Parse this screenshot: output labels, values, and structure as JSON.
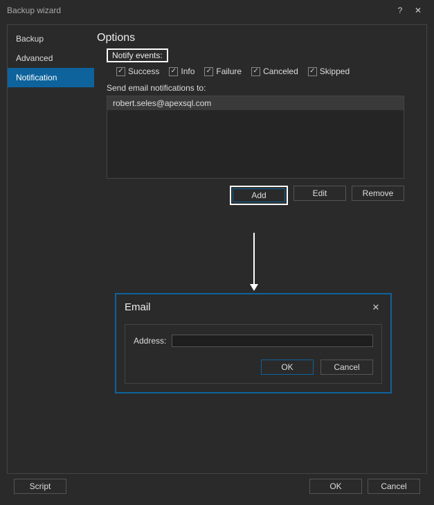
{
  "window": {
    "title": "Backup wizard"
  },
  "sidebar": {
    "items": [
      {
        "label": "Backup"
      },
      {
        "label": "Advanced"
      },
      {
        "label": "Notification"
      }
    ],
    "selected_index": 2
  },
  "options": {
    "heading": "Options",
    "notify_label": "Notify events:",
    "checks": {
      "success": {
        "label": "Success",
        "checked": true
      },
      "info": {
        "label": "Info",
        "checked": true
      },
      "failure": {
        "label": "Failure",
        "checked": true
      },
      "canceled": {
        "label": "Canceled",
        "checked": true
      },
      "skipped": {
        "label": "Skipped",
        "checked": true
      }
    },
    "send_label": "Send email notifications to:",
    "recipients": [
      "robert.seles@apexsql.com"
    ],
    "buttons": {
      "add": "Add",
      "edit": "Edit",
      "remove": "Remove"
    }
  },
  "email_dialog": {
    "title": "Email",
    "address_label": "Address:",
    "address_value": "",
    "ok": "OK",
    "cancel": "Cancel"
  },
  "footer": {
    "script": "Script",
    "ok": "OK",
    "cancel": "Cancel"
  },
  "glyphs": {
    "check": "✓",
    "help": "?",
    "close": "✕"
  }
}
